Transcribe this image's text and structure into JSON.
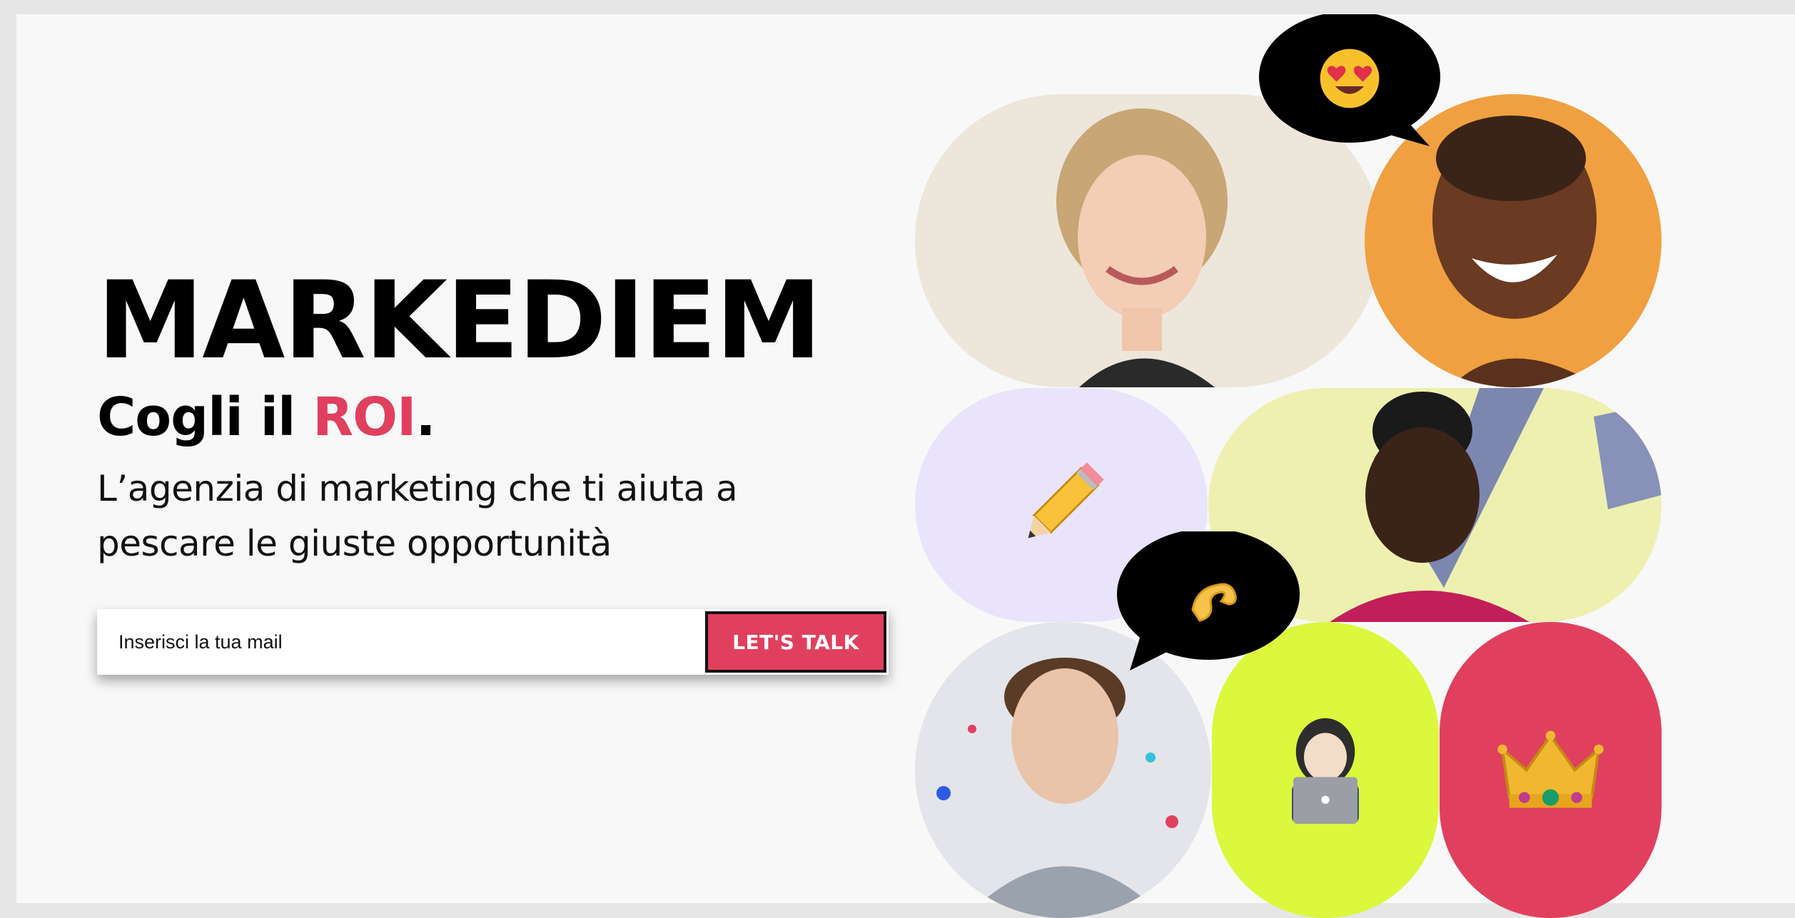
{
  "brand": "MARKEDIEM",
  "tagline": {
    "prefix": "Cogli il ",
    "accent": "ROI",
    "suffix": "."
  },
  "description": "L’agenzia di marketing che ti aiuta a pescare le giuste opportunità",
  "signup": {
    "placeholder": "Inserisci la tua mail",
    "button_label": "LET'S TALK"
  },
  "colors": {
    "accent": "#e0405e",
    "orange": "#f0a040",
    "lavender": "#e9e4fb",
    "lime": "#dcf83c",
    "black": "#000000"
  },
  "icons": [
    "heart-eyes-emoji",
    "pencil-emoji",
    "pinching-hand-emoji",
    "woman-laptop-emoji",
    "crown-emoji"
  ]
}
